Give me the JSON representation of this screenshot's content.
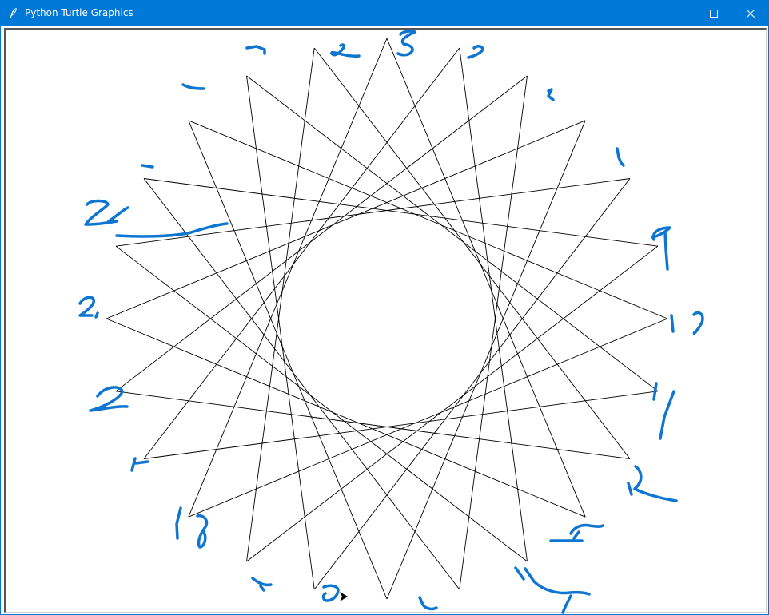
{
  "window": {
    "title": "Python Turtle Graphics",
    "icon": "feather-icon",
    "controls": [
      "minimize-icon",
      "maximize-icon",
      "close-icon"
    ],
    "accent_color": "#0078d7"
  },
  "canvas": {
    "background": "#ffffff",
    "line_color": "#000000",
    "star_points": 24,
    "turtle_cursor": "arrow-icon"
  },
  "annotations": {
    "ink_color": "#0e76d0",
    "labels": [
      "7",
      "8",
      "5",
      "8",
      "2",
      "4",
      "9",
      "12",
      "11",
      "12",
      "15",
      "14",
      "10",
      "5",
      "16",
      "18",
      "4",
      "20",
      "21",
      "22",
      "1",
      "1"
    ]
  }
}
